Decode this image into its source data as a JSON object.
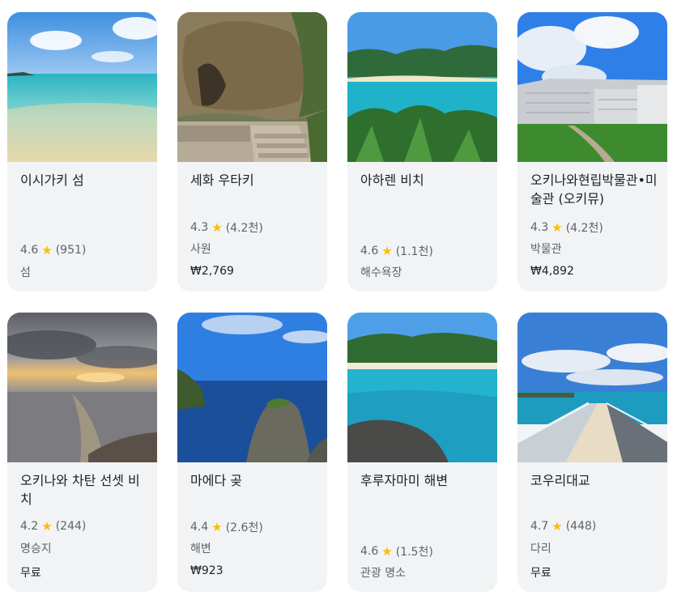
{
  "cards": [
    {
      "title": "이시가키 섬",
      "score": "4.6",
      "reviews": "(951)",
      "category": "섬",
      "price": ""
    },
    {
      "title": "세화 우타키",
      "score": "4.3",
      "reviews": "(4.2천)",
      "category": "사원",
      "price": "₩2,769"
    },
    {
      "title": "아하렌 비치",
      "score": "4.6",
      "reviews": "(1.1천)",
      "category": "해수욕장",
      "price": ""
    },
    {
      "title": "오키나와현립박물관•미술관 (오키뮤)",
      "score": "4.3",
      "reviews": "(4.2천)",
      "category": "박물관",
      "price": "₩4,892"
    },
    {
      "title": "오키나와 차탄 선셋 비치",
      "score": "4.2",
      "reviews": "(244)",
      "category": "명승지",
      "price": "무료"
    },
    {
      "title": "마에다 곶",
      "score": "4.4",
      "reviews": "(2.6천)",
      "category": "해변",
      "price": "₩923"
    },
    {
      "title": "후루자마미 해변",
      "score": "4.6",
      "reviews": "(1.5천)",
      "category": "관광 명소",
      "price": ""
    },
    {
      "title": "코우리대교",
      "score": "4.7",
      "reviews": "(448)",
      "category": "다리",
      "price": "무료"
    }
  ],
  "icons": {
    "rating": "star-icon"
  },
  "colors": {
    "star": "#fbbc04",
    "card_bg": "#f1f3f4"
  }
}
